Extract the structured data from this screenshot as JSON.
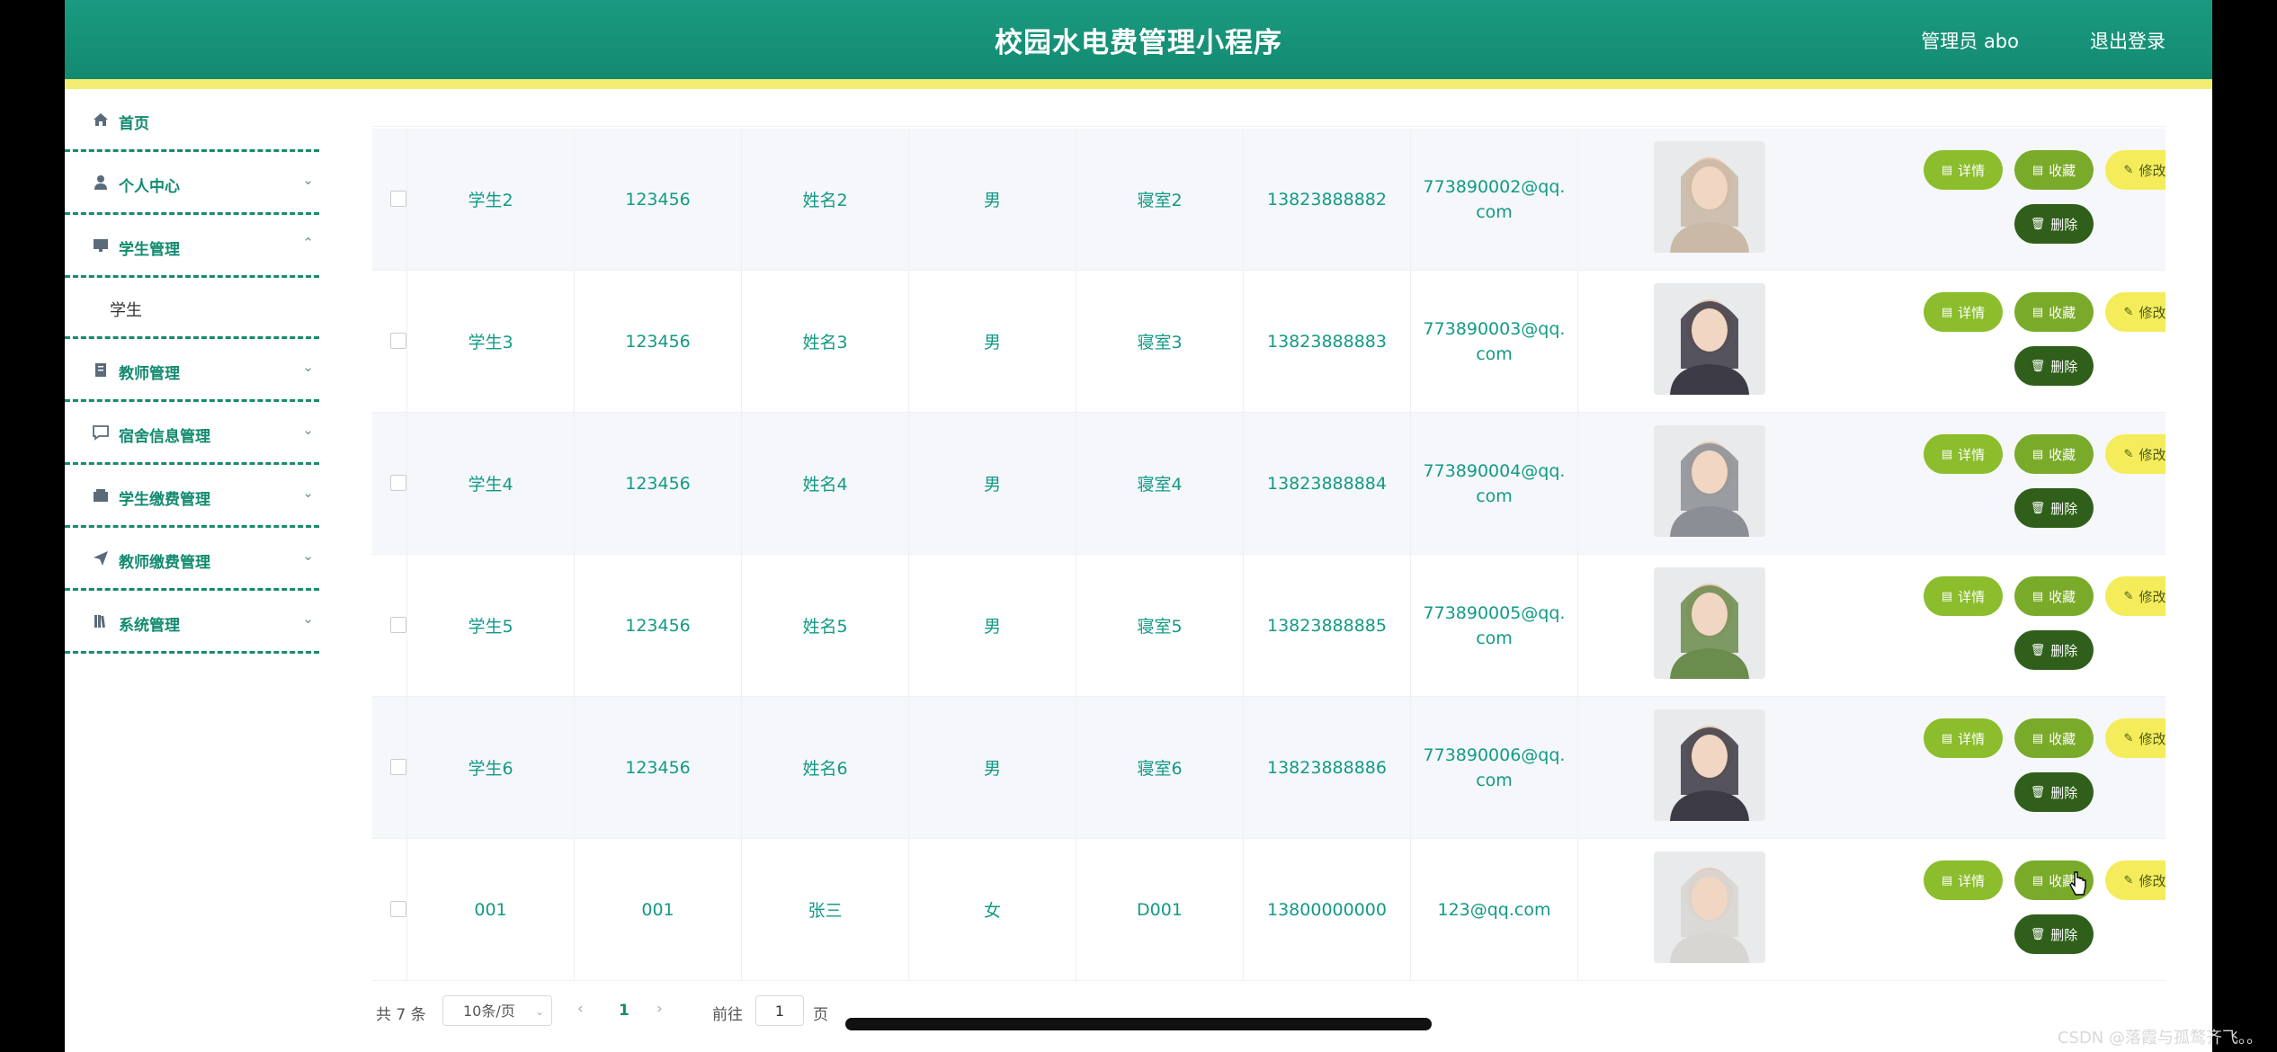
{
  "header": {
    "title": "校园水电费管理小程序",
    "user": "管理员 abo",
    "logout": "退出登录"
  },
  "sidebar": {
    "items": [
      {
        "label": "首页",
        "icon": "home-icon",
        "chev": ""
      },
      {
        "label": "个人中心",
        "icon": "user-icon",
        "chev": "⌄"
      },
      {
        "label": "学生管理",
        "icon": "monitor-icon",
        "chev": "⌃"
      },
      {
        "label": "教师管理",
        "icon": "clipboard-icon",
        "chev": "⌄"
      },
      {
        "label": "宿舍信息管理",
        "icon": "chat-icon",
        "chev": "⌄"
      },
      {
        "label": "学生缴费管理",
        "icon": "wallet-icon",
        "chev": "⌄"
      },
      {
        "label": "教师缴费管理",
        "icon": "send-icon",
        "chev": "⌄"
      },
      {
        "label": "系统管理",
        "icon": "book-icon",
        "chev": "⌄"
      }
    ],
    "sub": "学生"
  },
  "table": {
    "rows": [
      {
        "account": "学生2",
        "password": "123456",
        "name": "姓名2",
        "gender": "男",
        "dorm": "寝室2",
        "phone": "13823888882",
        "email": "773890002@qq.com"
      },
      {
        "account": "学生3",
        "password": "123456",
        "name": "姓名3",
        "gender": "男",
        "dorm": "寝室3",
        "phone": "13823888883",
        "email": "773890003@qq.com"
      },
      {
        "account": "学生4",
        "password": "123456",
        "name": "姓名4",
        "gender": "男",
        "dorm": "寝室4",
        "phone": "13823888884",
        "email": "773890004@qq.com"
      },
      {
        "account": "学生5",
        "password": "123456",
        "name": "姓名5",
        "gender": "男",
        "dorm": "寝室5",
        "phone": "13823888885",
        "email": "773890005@qq.com"
      },
      {
        "account": "学生6",
        "password": "123456",
        "name": "姓名6",
        "gender": "男",
        "dorm": "寝室6",
        "phone": "13823888886",
        "email": "773890006@qq.com"
      },
      {
        "account": "001",
        "password": "001",
        "name": "张三",
        "gender": "女",
        "dorm": "D001",
        "phone": "13800000000",
        "email": "123@qq.com"
      }
    ],
    "buttons": {
      "detail": "详情",
      "fav": "收藏",
      "edit": "修改",
      "del": "删除"
    }
  },
  "pagination": {
    "total": "共 7 条",
    "size": "10条/页",
    "current": "1",
    "goto": "前往",
    "goto_value": "1",
    "unit": "页"
  },
  "watermark": "CSDN @落霞与孤鹜齐飞。。",
  "colors": {
    "header": "#138a70",
    "accent": "#f1ee72",
    "text": "#139a86"
  }
}
